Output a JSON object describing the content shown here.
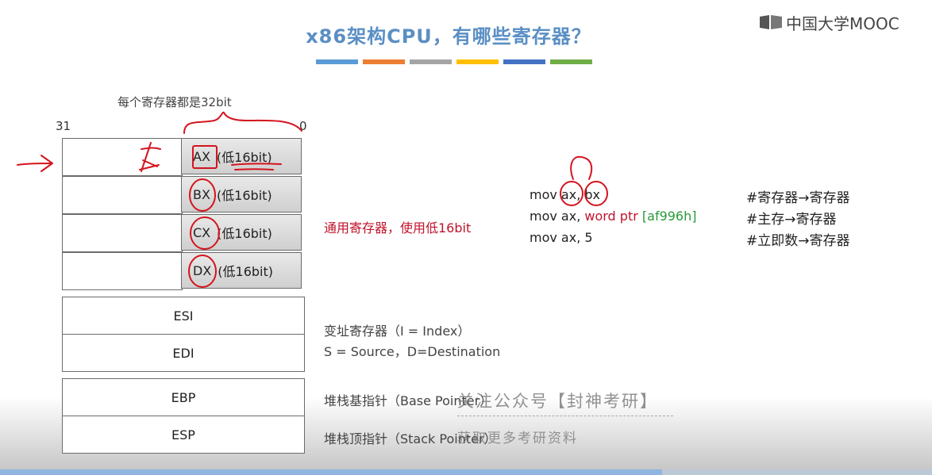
{
  "slide": {
    "title": "x86架构CPU，有哪些寄存器？",
    "accent_bars": [
      "#5b9bd5",
      "#ed7d31",
      "#a5a5a5",
      "#ffc000",
      "#4472c4",
      "#70ad47"
    ],
    "logo_text": "中国大学MOOC",
    "note_32bit": "每个寄存器都是32bit",
    "bit_high": "31",
    "bit_low": "0"
  },
  "general_registers": {
    "rows": [
      {
        "name": "AX",
        "suffix": "(低16bit)"
      },
      {
        "name": "BX",
        "suffix": "(低16bit)"
      },
      {
        "name": "CX",
        "suffix": "(低16bit)"
      },
      {
        "name": "DX",
        "suffix": "(低16bit)"
      }
    ],
    "description": "通用寄存器，使用低16bit"
  },
  "index_registers": {
    "rows": [
      "ESI",
      "EDI"
    ],
    "description_line1": "变址寄存器（I = Index）",
    "description_line2": "S = Source，D=Destination"
  },
  "stack_registers": {
    "rows": [
      {
        "name": "EBP",
        "description": "堆栈基指针（Base Pointer）"
      },
      {
        "name": "ESP",
        "description": "堆栈顶指针（Stack Pointer）"
      }
    ]
  },
  "code_examples": {
    "line1": {
      "text": "mov ax, bx",
      "comment": "#寄存器→寄存器"
    },
    "line2": {
      "prefix": "mov ax, ",
      "keyword": "word ptr ",
      "address": "[af996h]",
      "comment": "#主存→寄存器"
    },
    "line3": {
      "text": "mov ax, 5",
      "comment": "#立即数→寄存器"
    }
  },
  "watermark": {
    "line1": "关注公众号【封神考研】",
    "line2": "获取更多考研资料"
  },
  "video": {
    "progress_fraction": 0.71
  }
}
